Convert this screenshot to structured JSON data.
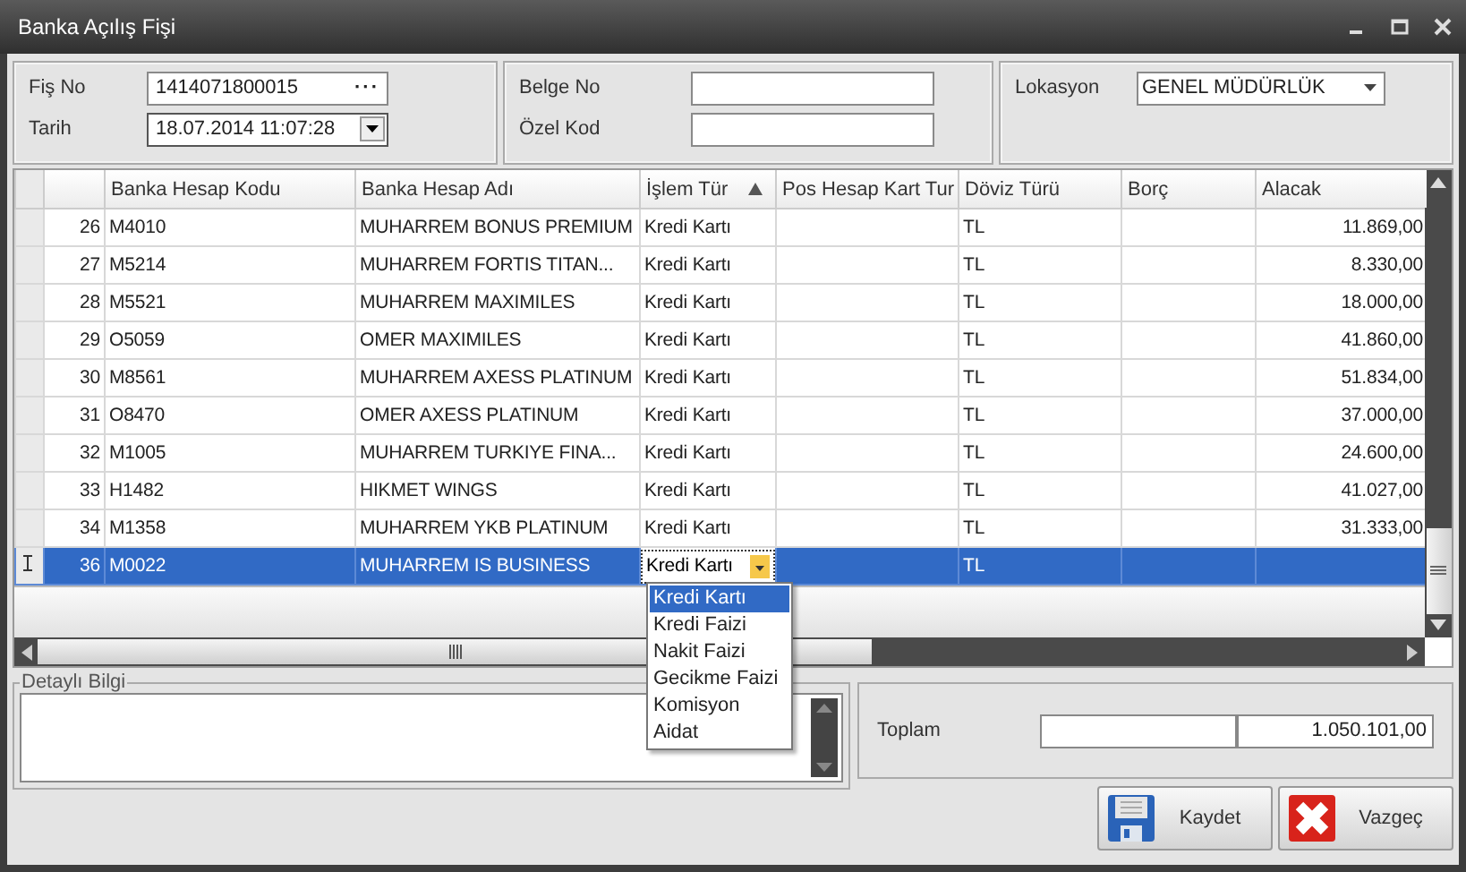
{
  "window": {
    "title": "Banka Açılış Fişi"
  },
  "header": {
    "fis_no": {
      "label": "Fiş No",
      "value": "1414071800015",
      "button": "···"
    },
    "tarih": {
      "label": "Tarih",
      "value": "18.07.2014 11:07:28"
    },
    "belge_no": {
      "label": "Belge No"
    },
    "ozel_kod": {
      "label": "Özel Kod"
    },
    "lokasyon": {
      "label": "Lokasyon",
      "value": "GENEL MÜDÜRLÜK"
    }
  },
  "table": {
    "columns": [
      {
        "label": "Banka Hesap Kodu",
        "sorted": false
      },
      {
        "label": "Banka Hesap Adı",
        "sorted": false
      },
      {
        "label": "İşlem Tür",
        "sorted": true
      },
      {
        "label": "Pos Hesap Kart Tur",
        "sorted": false
      },
      {
        "label": "Döviz Türü",
        "sorted": false
      },
      {
        "label": "Borç",
        "sorted": false
      },
      {
        "label": "Alacak",
        "sorted": false
      }
    ],
    "rows": [
      {
        "no": "26",
        "code": "M4010",
        "name": "MUHARREM BONUS PREMIUM",
        "type": "Kredi Kartı",
        "currency": "TL",
        "credit": "11.869,00",
        "selected": false
      },
      {
        "no": "27",
        "code": "M5214",
        "name": "MUHARREM FORTIS TITAN...",
        "type": "Kredi Kartı",
        "currency": "TL",
        "credit": "8.330,00",
        "selected": false
      },
      {
        "no": "28",
        "code": "M5521",
        "name": "MUHARREM MAXIMILES",
        "type": "Kredi Kartı",
        "currency": "TL",
        "credit": "18.000,00",
        "selected": false
      },
      {
        "no": "29",
        "code": "O5059",
        "name": "OMER MAXIMILES",
        "type": "Kredi Kartı",
        "currency": "TL",
        "credit": "41.860,00",
        "selected": false
      },
      {
        "no": "30",
        "code": "M8561",
        "name": "MUHARREM AXESS PLATINUM",
        "type": "Kredi Kartı",
        "currency": "TL",
        "credit": "51.834,00",
        "selected": false
      },
      {
        "no": "31",
        "code": "O8470",
        "name": "OMER AXESS PLATINUM",
        "type": "Kredi Kartı",
        "currency": "TL",
        "credit": "37.000,00",
        "selected": false
      },
      {
        "no": "32",
        "code": "M1005",
        "name": "MUHARREM TURKIYE FINA...",
        "type": "Kredi Kartı",
        "currency": "TL",
        "credit": "24.600,00",
        "selected": false
      },
      {
        "no": "33",
        "code": "H1482",
        "name": "HIKMET WINGS",
        "type": "Kredi Kartı",
        "currency": "TL",
        "credit": "41.027,00",
        "selected": false
      },
      {
        "no": "34",
        "code": "M1358",
        "name": "MUHARREM YKB PLATINUM",
        "type": "Kredi Kartı",
        "currency": "TL",
        "credit": "31.333,00",
        "selected": false
      },
      {
        "no": "36",
        "code": "M0022",
        "name": "MUHARREM IS BUSINESS",
        "type": "Kredi Kartı",
        "currency": "TL",
        "selected": true
      }
    ],
    "dropdown": [
      {
        "label": "Kredi Kartı",
        "selected": true
      },
      {
        "label": "Kredi Faizi",
        "selected": false
      },
      {
        "label": "Nakit Faizi",
        "selected": false
      },
      {
        "label": "Gecikme Faizi",
        "selected": false
      },
      {
        "label": "Komisyon",
        "selected": false
      },
      {
        "label": "Aidat",
        "selected": false
      }
    ]
  },
  "detail": {
    "label": "Detaylı Bilgi"
  },
  "total": {
    "label": "Toplam",
    "value": "1.050.101,00"
  },
  "buttons": [
    {
      "label": "Kaydet",
      "kind": "save"
    },
    {
      "label": "Vazgeç",
      "kind": "cancel"
    }
  ]
}
